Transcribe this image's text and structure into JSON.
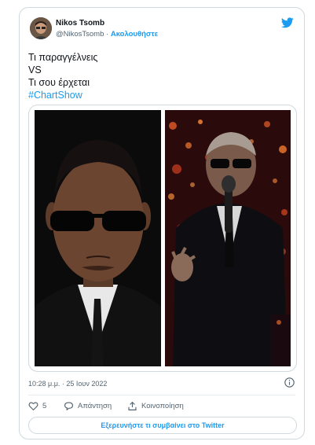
{
  "tweet": {
    "author": {
      "name": "Nikos Tsomb",
      "handle": "@NikosTsomb",
      "separator": "·",
      "follow_label": "Ακολουθήστε"
    },
    "lines": [
      "Τι παραγγέλνεις",
      "VS",
      "Τι σου έρχεται"
    ],
    "hashtag": "#ChartShow",
    "timestamp": "10:28 μ.μ. · 25 Ιουν 2022",
    "likes_count": "5",
    "reply_label": "Απάντηση",
    "share_label": "Κοινοποίηση",
    "explore_label": "Εξερευνήστε τι συμβαίνει στο Twitter"
  },
  "icons": {
    "brand": "twitter-bird-icon",
    "info": "info-icon",
    "like": "heart-icon",
    "reply": "reply-bubble-icon",
    "share": "share-icon"
  },
  "colors": {
    "accent": "#1d9bf0",
    "text": "#0f1419",
    "muted": "#536471",
    "border": "#cfd9de"
  }
}
